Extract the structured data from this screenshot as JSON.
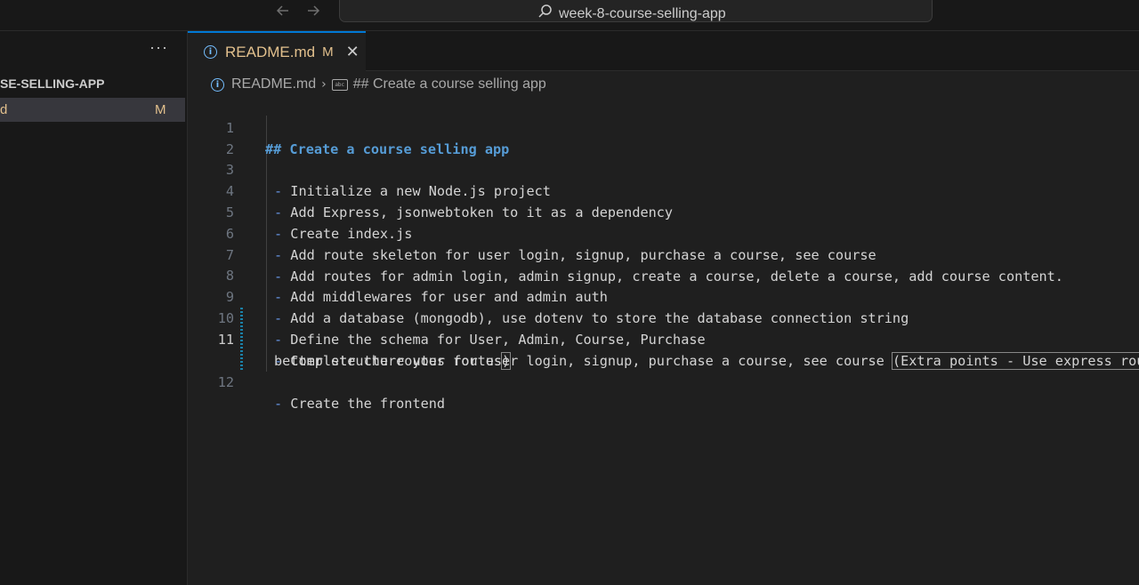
{
  "titlebar": {
    "back_icon": "arrow-left-icon",
    "forward_icon": "arrow-right-icon",
    "search_text": "week-8-course-selling-app"
  },
  "sidebar": {
    "more_label": "···",
    "folder_label": "SE-SELLING-APP",
    "file_label": "d",
    "file_status": "M"
  },
  "tab": {
    "label": "README.md",
    "status": "M",
    "close": "✕"
  },
  "breadcrumb": {
    "file": "README.md",
    "symbol": "## Create a course selling app"
  },
  "editor": {
    "active_line": 11,
    "lines": [
      {
        "n": "1",
        "text": "## Create a course selling app"
      },
      {
        "n": "2",
        "text": ""
      },
      {
        "n": "3",
        "text": "Initialize a new Node.js project"
      },
      {
        "n": "4",
        "text": "Add Express, jsonwebtoken to it as a dependency"
      },
      {
        "n": "5",
        "text": "Create index.js"
      },
      {
        "n": "6",
        "text": "Add route skeleton for user login, signup, purchase a course, see course"
      },
      {
        "n": "7",
        "text": "Add routes for admin login, admin signup, create a course, delete a course, add course content."
      },
      {
        "n": "8",
        "text": "Add middlewares for user and admin auth"
      },
      {
        "n": "9",
        "text": "Add a database (mongodb), use dotenv to store the database connection string"
      },
      {
        "n": "10",
        "text": "Define the schema for User, Admin, Course, Purchase"
      },
      {
        "n": "11",
        "text_before": "Complete the routes for user login, signup, purchase a course, see course ",
        "text_paren": "(Extra points - Use express routing to",
        "wrap_before": "better structure your routes",
        "wrap_paren": ")"
      },
      {
        "n": "12",
        "text": "Create the frontend"
      }
    ]
  },
  "colors": {
    "accent": "#0078d4",
    "modified": "#e2c08d",
    "heading": "#569cd6",
    "list_marker": "#6796e6"
  }
}
